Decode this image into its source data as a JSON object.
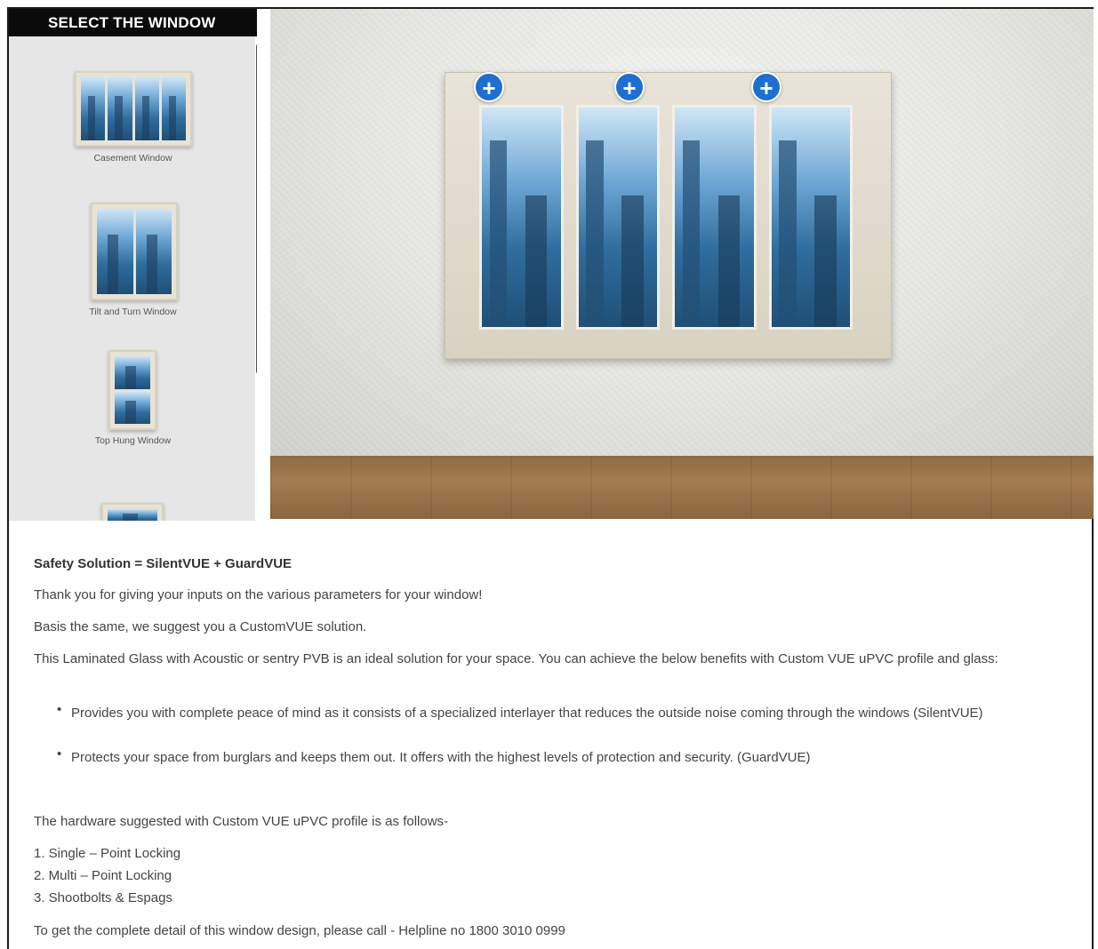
{
  "sidebar": {
    "header": "SELECT THE WINDOW",
    "options": [
      {
        "label": "Casement Window"
      },
      {
        "label": "Tilt and Turn Window"
      },
      {
        "label": "Top Hung Window"
      }
    ]
  },
  "scene": {
    "add_buttons": [
      "+",
      "+",
      "+"
    ]
  },
  "content": {
    "heading": "Safety Solution = SilentVUE + GuardVUE",
    "thanks": "Thank you for giving your inputs on the various parameters for your window!",
    "suggest": "Basis the same, we suggest you a CustomVUE solution.",
    "description": "This Laminated Glass with Acoustic or sentry PVB is an ideal solution for your space. You can achieve the below benefits with Custom VUE uPVC profile and glass:",
    "benefits": [
      "Provides you with complete peace of mind as it consists of a specialized interlayer that reduces the outside noise coming through the windows (SilentVUE)",
      "Protects your space from burglars and keeps them out. It offers with the highest levels of protection and security. (GuardVUE)"
    ],
    "hardware_intro": "The hardware suggested with Custom VUE uPVC profile is as follows-",
    "hardware": [
      "1. Single – Point Locking",
      "2. Multi – Point Locking",
      "3. Shootbolts & Espags"
    ],
    "contact": "To get the complete detail of this window design, please call - Helpline no 1800 3010 0999"
  },
  "colors": {
    "accent_blue": "#1f6fd1",
    "header_black": "#0b0b0b",
    "sidebar_bg": "#e6e6e6"
  }
}
